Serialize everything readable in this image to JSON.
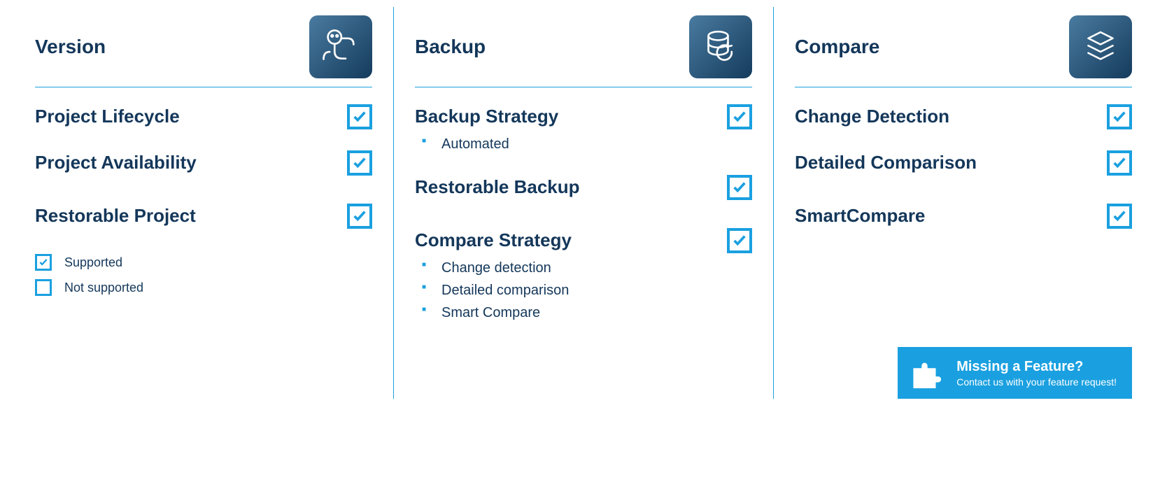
{
  "columns": [
    {
      "title": "Version",
      "icon": "robot-icon",
      "features": [
        {
          "label": "Project Lifecycle",
          "checked": true,
          "subitems": []
        },
        {
          "label": "Project Availability",
          "checked": true,
          "subitems": []
        },
        {
          "label": "Restorable Project",
          "checked": true,
          "subitems": []
        }
      ]
    },
    {
      "title": "Backup",
      "icon": "database-restore-icon",
      "features": [
        {
          "label": "Backup Strategy",
          "checked": true,
          "subitems": [
            "Automated"
          ]
        },
        {
          "label": "Restorable Backup",
          "checked": true,
          "subitems": []
        },
        {
          "label": "Compare Strategy",
          "checked": true,
          "subitems": [
            "Change detection",
            "Detailed comparison",
            "Smart Compare"
          ]
        }
      ]
    },
    {
      "title": "Compare",
      "icon": "layers-icon",
      "features": [
        {
          "label": "Change Detection",
          "checked": true,
          "subitems": []
        },
        {
          "label": "Detailed Comparison",
          "checked": true,
          "subitems": []
        },
        {
          "label": "SmartCompare",
          "checked": true,
          "subitems": []
        }
      ]
    }
  ],
  "legend": {
    "supported": "Supported",
    "not_supported": "Not supported"
  },
  "cta": {
    "title": "Missing a Feature?",
    "sub": "Contact us with your feature request!"
  }
}
